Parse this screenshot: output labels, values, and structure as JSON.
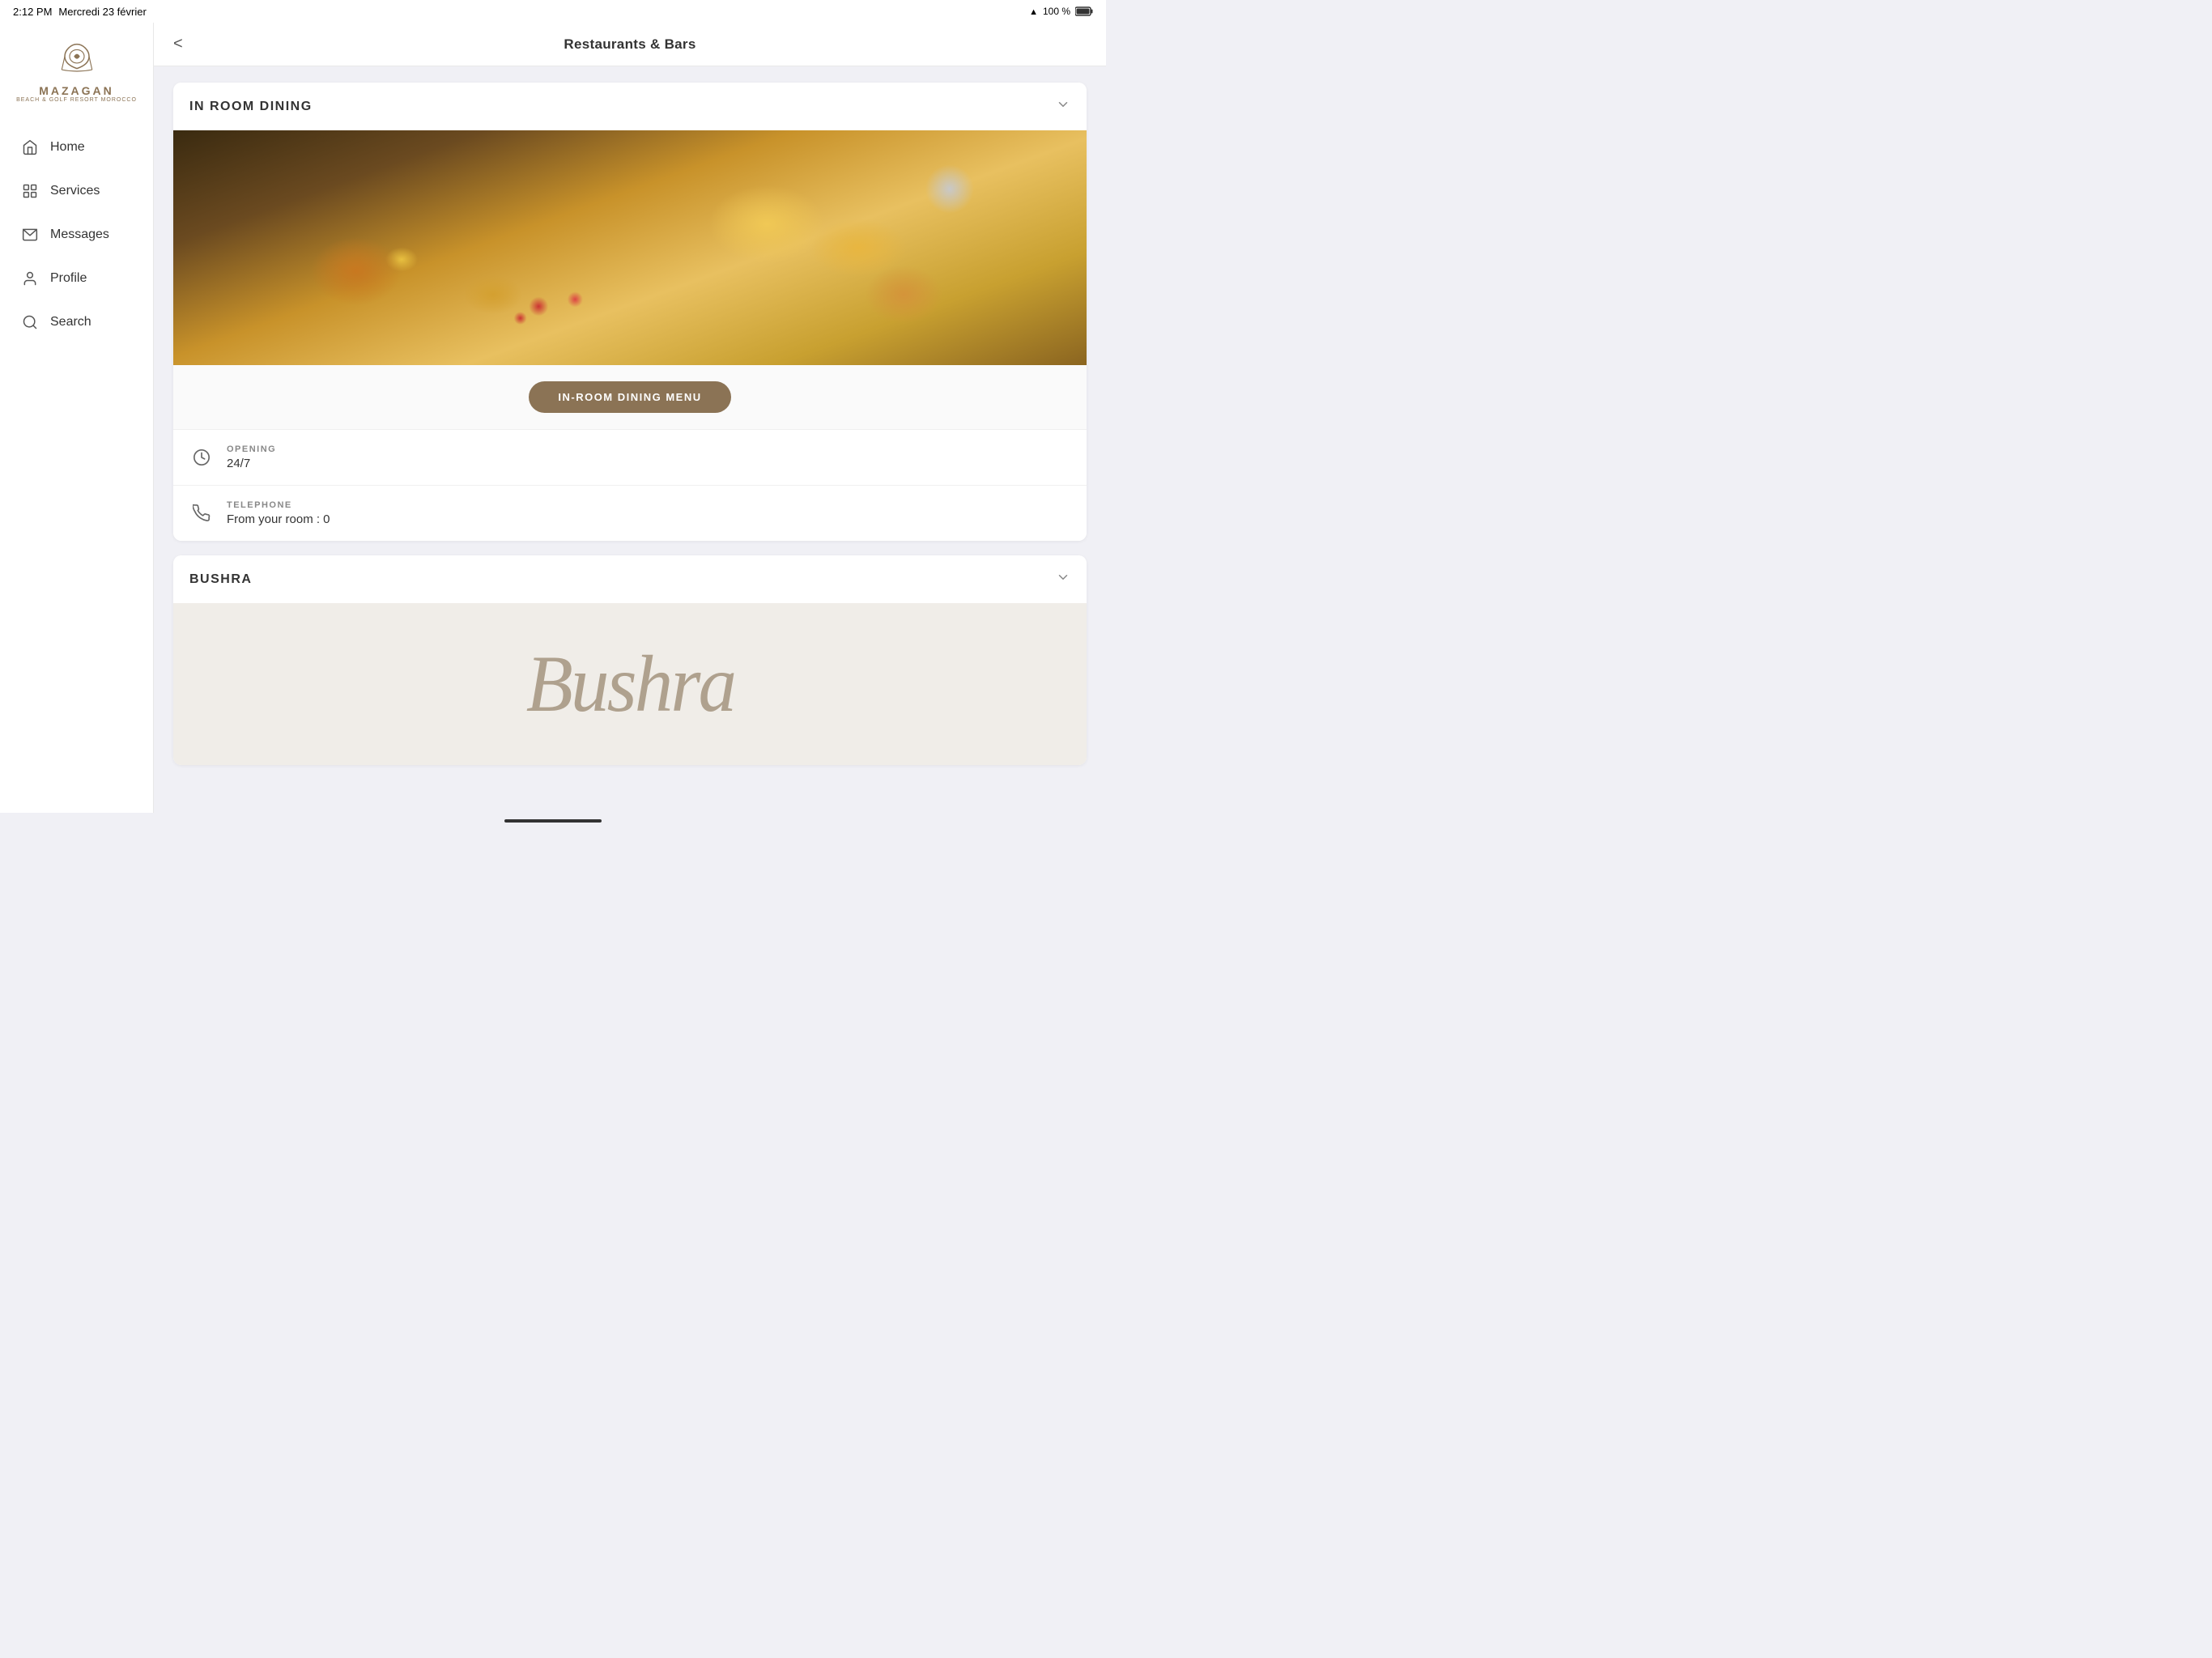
{
  "statusBar": {
    "time": "2:12 PM",
    "date": "Mercredi 23 février",
    "battery": "100 %"
  },
  "logo": {
    "name": "MAZAGAN",
    "tagline": "Beach & Golf Resort Morocco"
  },
  "nav": {
    "items": [
      {
        "id": "home",
        "label": "Home",
        "icon": "🏠"
      },
      {
        "id": "services",
        "label": "Services",
        "icon": "⊞"
      },
      {
        "id": "messages",
        "label": "Messages",
        "icon": "✉"
      },
      {
        "id": "profile",
        "label": "Profile",
        "icon": "👤"
      },
      {
        "id": "search",
        "label": "Search",
        "icon": "🔍"
      }
    ]
  },
  "topNav": {
    "title": "Restaurants & Bars",
    "backLabel": "<"
  },
  "sections": [
    {
      "id": "in-room-dining",
      "title": "IN ROOM DINING",
      "menuButtonLabel": "IN-ROOM DINING MENU",
      "opening": {
        "label": "OPENING",
        "value": "24/7"
      },
      "telephone": {
        "label": "TELEPHONE",
        "value": "From your room : 0"
      }
    },
    {
      "id": "bushra",
      "title": "BUSHRA",
      "logoText": "Bushra"
    }
  ]
}
